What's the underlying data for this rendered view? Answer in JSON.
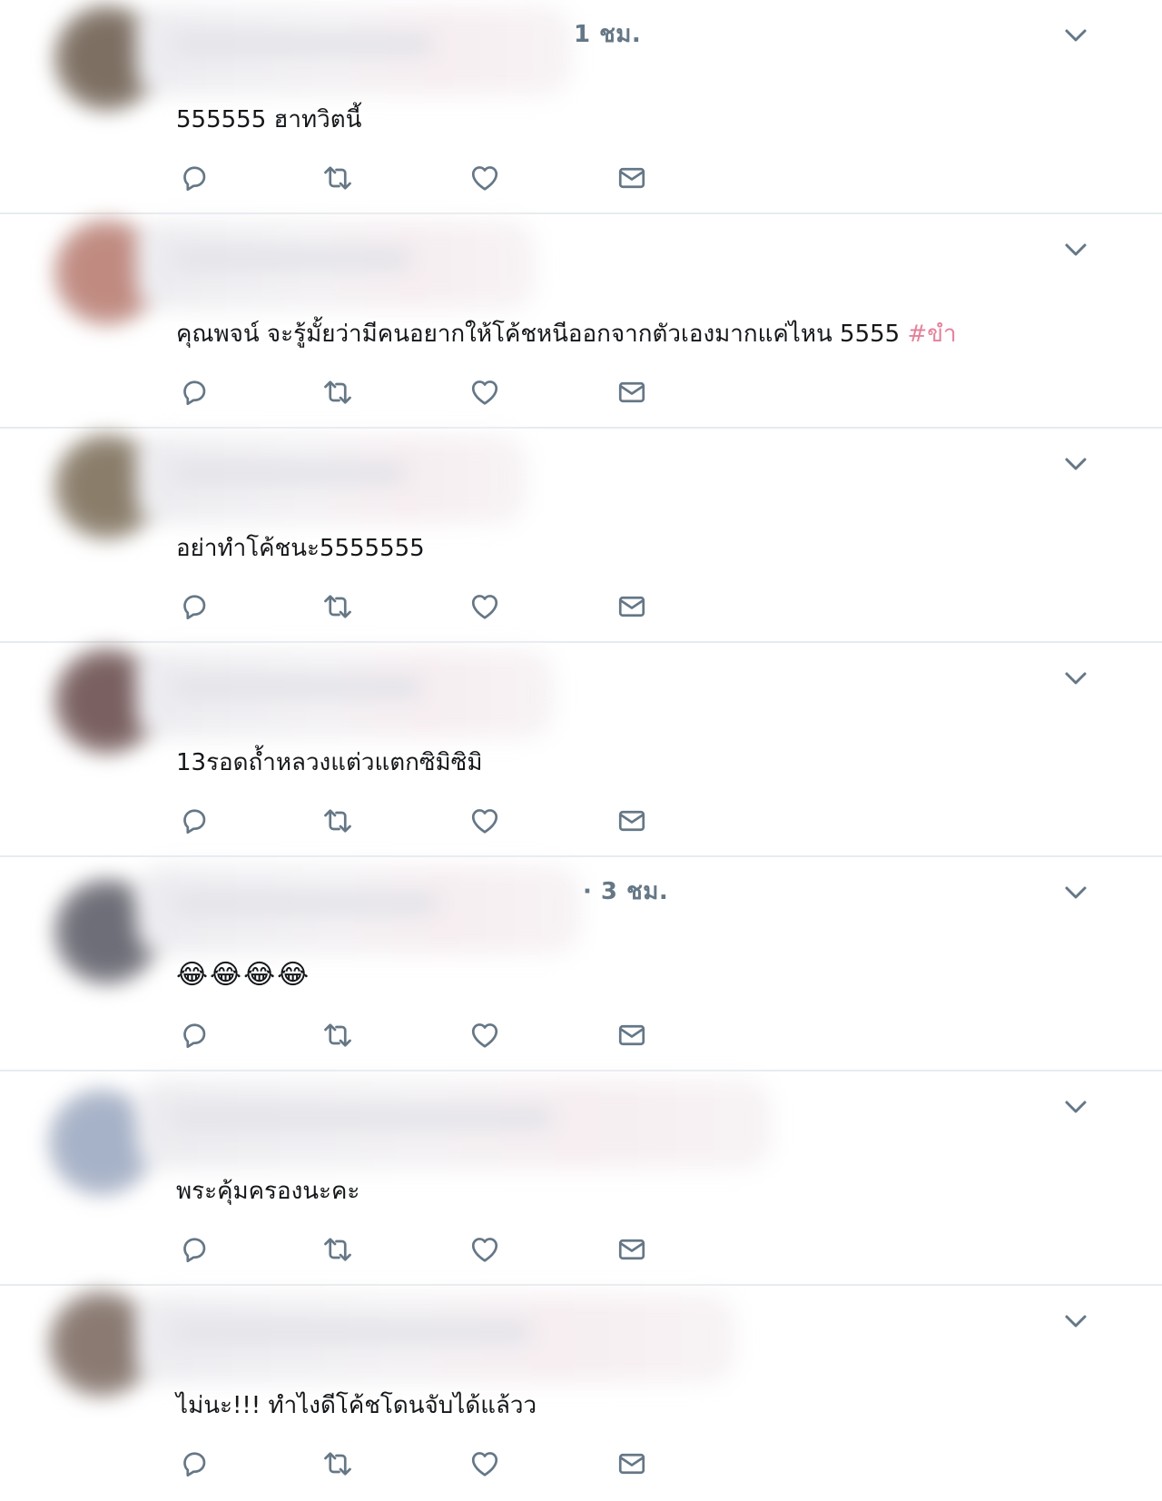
{
  "colors": {
    "text": "#14171a",
    "meta": "#657786",
    "icon": "#657786",
    "hashtag": "#e4819b",
    "divider": "#e6ecf0"
  },
  "tweets": [
    {
      "meta": "1 ชม.",
      "text": "555555 ฮาทวิตนี้",
      "hashtag": "",
      "avatar_color": "#7d6f62"
    },
    {
      "meta": "",
      "text": "คุณพจน์ จะรู้มั้ยว่ามีคนอยากให้โค้ชหนีออกจากตัวเองมากแค่ไหน 5555 ",
      "hashtag": "#ขำ",
      "avatar_color": "#c08a80"
    },
    {
      "meta": "",
      "text": "อย่าทำโค้ชนะ5555555",
      "hashtag": "",
      "avatar_color": "#8a7d6a"
    },
    {
      "meta": "",
      "text": "13รอดถ้ำหลวงแต่วแตกซิมิซิมิ",
      "hashtag": "",
      "avatar_color": "#7a6060"
    },
    {
      "meta": "· 3 ชม.",
      "text": "😂😂😂😂",
      "hashtag": "",
      "avatar_color": "#6e6e78"
    },
    {
      "meta": "",
      "text": "พระคุ้มครองนะคะ",
      "hashtag": "",
      "avatar_color": "#a6b2c8"
    },
    {
      "meta": "",
      "text": "ไม่นะ!!! ทำไงดีโค้ชโดนจับได้แล้วว",
      "hashtag": "",
      "avatar_color": "#8a7a72"
    }
  ],
  "icons": {
    "more": "chevron-down-icon",
    "reply": "reply-icon",
    "retweet": "retweet-icon",
    "like": "heart-icon",
    "dm": "envelope-icon"
  }
}
